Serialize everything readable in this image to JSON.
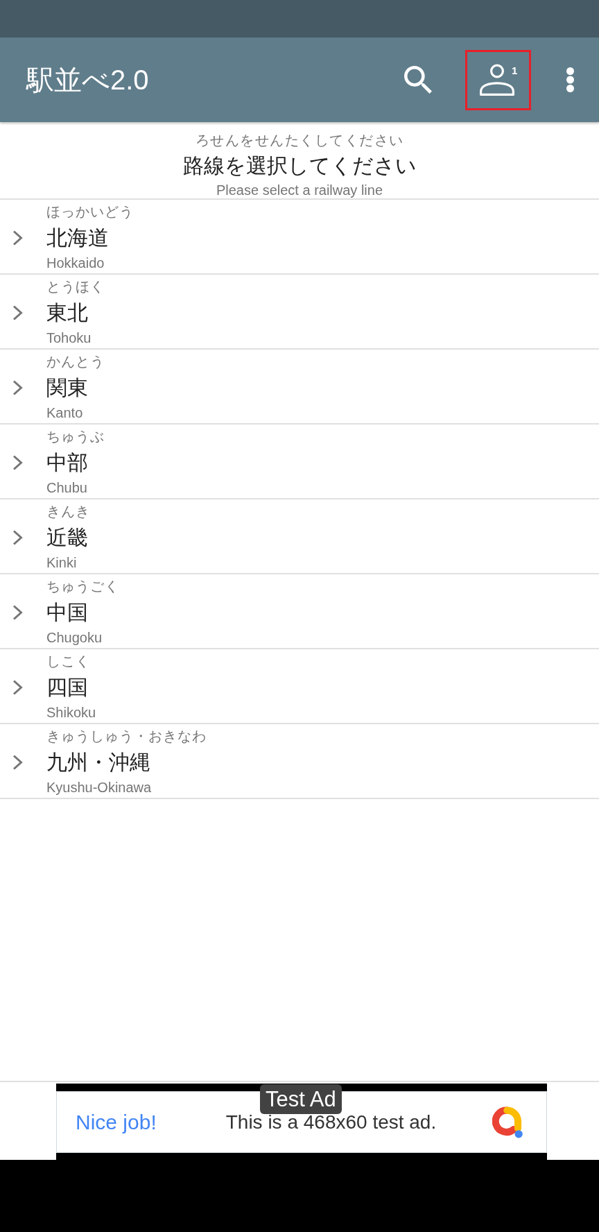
{
  "app_bar": {
    "title": "駅並べ2.0",
    "actions": [
      {
        "kind": "search"
      },
      {
        "kind": "account",
        "badge": "1",
        "highlighted": true
      },
      {
        "kind": "more"
      }
    ]
  },
  "header": {
    "reading": "ろせんをせんたくしてください",
    "title": "路線を選択してください",
    "subtitle": "Please select a railway line"
  },
  "regions": [
    {
      "reading": "ほっかいどう",
      "name": "北海道",
      "english": "Hokkaido",
      "expanded": false
    },
    {
      "reading": "とうほく",
      "name": "東北",
      "english": "Tohoku",
      "expanded": false
    },
    {
      "reading": "かんとう",
      "name": "関東",
      "english": "Kanto",
      "expanded": false
    },
    {
      "reading": "ちゅうぶ",
      "name": "中部",
      "english": "Chubu",
      "expanded": false
    },
    {
      "reading": "きんき",
      "name": "近畿",
      "english": "Kinki",
      "expanded": false
    },
    {
      "reading": "ちゅうごく",
      "name": "中国",
      "english": "Chugoku",
      "expanded": false
    },
    {
      "reading": "しこく",
      "name": "四国",
      "english": "Shikoku",
      "expanded": false
    },
    {
      "reading": "きゅうしゅう・おきなわ",
      "name": "九州・沖縄",
      "english": "Kyushu-Okinawa",
      "expanded": false
    }
  ],
  "ad": {
    "label": "Test Ad",
    "headline": "Nice job!",
    "text": "This is a 468x60 test ad."
  }
}
